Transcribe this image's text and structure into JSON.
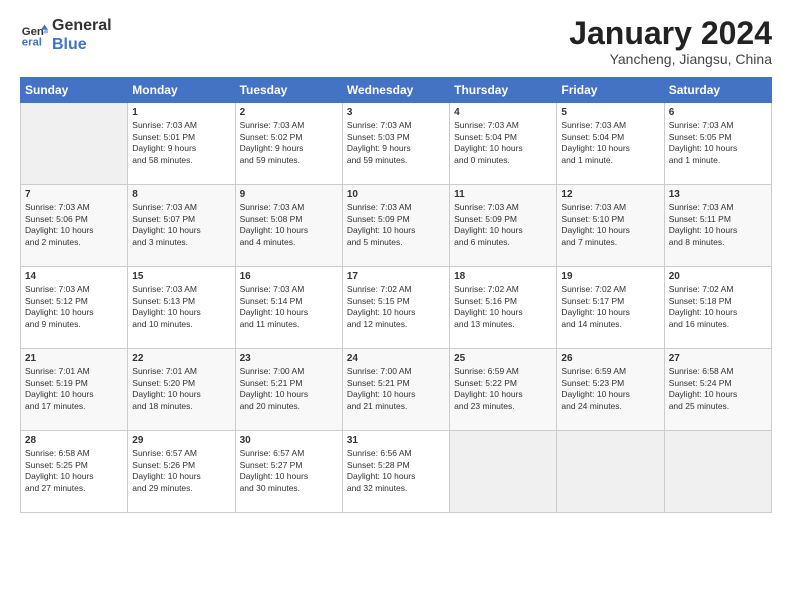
{
  "logo": {
    "line1": "General",
    "line2": "Blue"
  },
  "title": "January 2024",
  "subtitle": "Yancheng, Jiangsu, China",
  "days_header": [
    "Sunday",
    "Monday",
    "Tuesday",
    "Wednesday",
    "Thursday",
    "Friday",
    "Saturday"
  ],
  "weeks": [
    [
      {
        "num": "",
        "info": ""
      },
      {
        "num": "1",
        "info": "Sunrise: 7:03 AM\nSunset: 5:01 PM\nDaylight: 9 hours\nand 58 minutes."
      },
      {
        "num": "2",
        "info": "Sunrise: 7:03 AM\nSunset: 5:02 PM\nDaylight: 9 hours\nand 59 minutes."
      },
      {
        "num": "3",
        "info": "Sunrise: 7:03 AM\nSunset: 5:03 PM\nDaylight: 9 hours\nand 59 minutes."
      },
      {
        "num": "4",
        "info": "Sunrise: 7:03 AM\nSunset: 5:04 PM\nDaylight: 10 hours\nand 0 minutes."
      },
      {
        "num": "5",
        "info": "Sunrise: 7:03 AM\nSunset: 5:04 PM\nDaylight: 10 hours\nand 1 minute."
      },
      {
        "num": "6",
        "info": "Sunrise: 7:03 AM\nSunset: 5:05 PM\nDaylight: 10 hours\nand 1 minute."
      }
    ],
    [
      {
        "num": "7",
        "info": "Sunrise: 7:03 AM\nSunset: 5:06 PM\nDaylight: 10 hours\nand 2 minutes."
      },
      {
        "num": "8",
        "info": "Sunrise: 7:03 AM\nSunset: 5:07 PM\nDaylight: 10 hours\nand 3 minutes."
      },
      {
        "num": "9",
        "info": "Sunrise: 7:03 AM\nSunset: 5:08 PM\nDaylight: 10 hours\nand 4 minutes."
      },
      {
        "num": "10",
        "info": "Sunrise: 7:03 AM\nSunset: 5:09 PM\nDaylight: 10 hours\nand 5 minutes."
      },
      {
        "num": "11",
        "info": "Sunrise: 7:03 AM\nSunset: 5:09 PM\nDaylight: 10 hours\nand 6 minutes."
      },
      {
        "num": "12",
        "info": "Sunrise: 7:03 AM\nSunset: 5:10 PM\nDaylight: 10 hours\nand 7 minutes."
      },
      {
        "num": "13",
        "info": "Sunrise: 7:03 AM\nSunset: 5:11 PM\nDaylight: 10 hours\nand 8 minutes."
      }
    ],
    [
      {
        "num": "14",
        "info": "Sunrise: 7:03 AM\nSunset: 5:12 PM\nDaylight: 10 hours\nand 9 minutes."
      },
      {
        "num": "15",
        "info": "Sunrise: 7:03 AM\nSunset: 5:13 PM\nDaylight: 10 hours\nand 10 minutes."
      },
      {
        "num": "16",
        "info": "Sunrise: 7:03 AM\nSunset: 5:14 PM\nDaylight: 10 hours\nand 11 minutes."
      },
      {
        "num": "17",
        "info": "Sunrise: 7:02 AM\nSunset: 5:15 PM\nDaylight: 10 hours\nand 12 minutes."
      },
      {
        "num": "18",
        "info": "Sunrise: 7:02 AM\nSunset: 5:16 PM\nDaylight: 10 hours\nand 13 minutes."
      },
      {
        "num": "19",
        "info": "Sunrise: 7:02 AM\nSunset: 5:17 PM\nDaylight: 10 hours\nand 14 minutes."
      },
      {
        "num": "20",
        "info": "Sunrise: 7:02 AM\nSunset: 5:18 PM\nDaylight: 10 hours\nand 16 minutes."
      }
    ],
    [
      {
        "num": "21",
        "info": "Sunrise: 7:01 AM\nSunset: 5:19 PM\nDaylight: 10 hours\nand 17 minutes."
      },
      {
        "num": "22",
        "info": "Sunrise: 7:01 AM\nSunset: 5:20 PM\nDaylight: 10 hours\nand 18 minutes."
      },
      {
        "num": "23",
        "info": "Sunrise: 7:00 AM\nSunset: 5:21 PM\nDaylight: 10 hours\nand 20 minutes."
      },
      {
        "num": "24",
        "info": "Sunrise: 7:00 AM\nSunset: 5:21 PM\nDaylight: 10 hours\nand 21 minutes."
      },
      {
        "num": "25",
        "info": "Sunrise: 6:59 AM\nSunset: 5:22 PM\nDaylight: 10 hours\nand 23 minutes."
      },
      {
        "num": "26",
        "info": "Sunrise: 6:59 AM\nSunset: 5:23 PM\nDaylight: 10 hours\nand 24 minutes."
      },
      {
        "num": "27",
        "info": "Sunrise: 6:58 AM\nSunset: 5:24 PM\nDaylight: 10 hours\nand 25 minutes."
      }
    ],
    [
      {
        "num": "28",
        "info": "Sunrise: 6:58 AM\nSunset: 5:25 PM\nDaylight: 10 hours\nand 27 minutes."
      },
      {
        "num": "29",
        "info": "Sunrise: 6:57 AM\nSunset: 5:26 PM\nDaylight: 10 hours\nand 29 minutes."
      },
      {
        "num": "30",
        "info": "Sunrise: 6:57 AM\nSunset: 5:27 PM\nDaylight: 10 hours\nand 30 minutes."
      },
      {
        "num": "31",
        "info": "Sunrise: 6:56 AM\nSunset: 5:28 PM\nDaylight: 10 hours\nand 32 minutes."
      },
      {
        "num": "",
        "info": ""
      },
      {
        "num": "",
        "info": ""
      },
      {
        "num": "",
        "info": ""
      }
    ]
  ]
}
